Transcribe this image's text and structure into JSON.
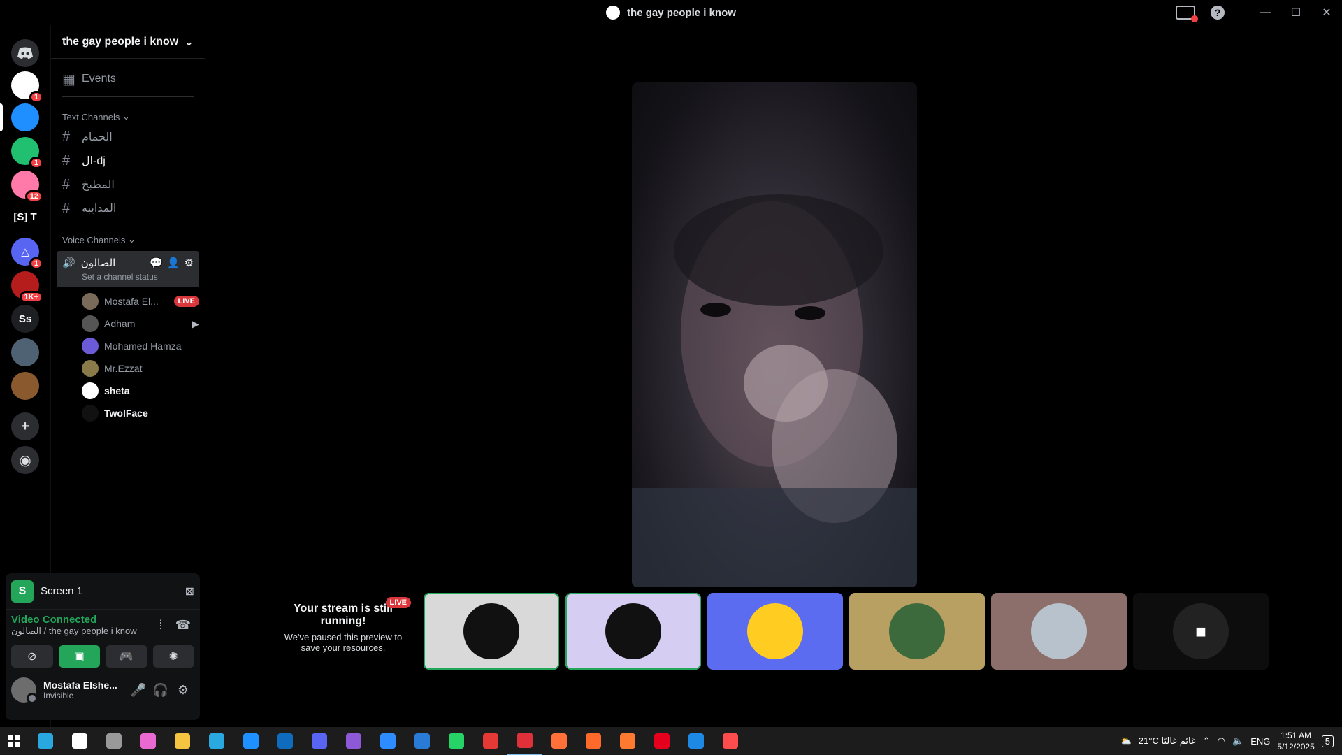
{
  "window": {
    "title": "the gay people i know"
  },
  "rail": {
    "servers": [
      {
        "name": "server-1",
        "badge": "1",
        "color": "#ffffff",
        "label": ""
      },
      {
        "name": "server-2",
        "badge": "",
        "color": "#1f8fff",
        "label": ""
      },
      {
        "name": "server-3",
        "badge": "1",
        "color": "#20c070",
        "label": ""
      },
      {
        "name": "server-4",
        "badge": "12",
        "color": "#ff7aa8",
        "label": ""
      },
      {
        "name": "server-5",
        "badge": "",
        "color": "#000000",
        "label": "[S] T"
      },
      {
        "name": "server-6",
        "badge": "1",
        "color": "#5865f2",
        "label": "△"
      },
      {
        "name": "server-7",
        "badge": "1K+",
        "color": "#b51d1d",
        "label": ""
      },
      {
        "name": "server-8",
        "badge": "",
        "color": "#1e1f22",
        "label": "Ss"
      },
      {
        "name": "server-9",
        "badge": "",
        "color": "#4f6273",
        "label": ""
      },
      {
        "name": "server-10",
        "badge": "",
        "color": "#8a5a2e",
        "label": ""
      }
    ]
  },
  "sidebar": {
    "guild_name": "the gay people i know",
    "events": "Events",
    "text_category": "Text Channels",
    "text_channels": [
      "الحمام",
      "ال-dj",
      "المطبخ",
      "المدايبه"
    ],
    "voice_category": "Voice Channels",
    "voice_channel": {
      "name": "الصالون",
      "status": "Set a channel status"
    },
    "members": [
      {
        "name": "Mostafa El...",
        "tag": "LIVE",
        "color": "#7a6a5a"
      },
      {
        "name": "Adham",
        "tag": "",
        "color": "#555555"
      },
      {
        "name": "Mohamed Hamza",
        "tag": "",
        "color": "#6b5bd6"
      },
      {
        "name": "Mr.Ezzat",
        "tag": "",
        "color": "#8a7a4a"
      },
      {
        "name": "sheta",
        "tag": "",
        "color": "#ffffff"
      },
      {
        "name": "TwolFace",
        "tag": "",
        "color": "#111111"
      }
    ]
  },
  "panel": {
    "screen_label": "Screen 1",
    "vc_title": "Video Connected",
    "vc_sub": "الصالون / the gay people i know",
    "user_name": "Mostafa Elshe...",
    "user_status": "Invisible"
  },
  "stage": {
    "paused_title": "Your stream is still running!",
    "paused_body": "We've paused this preview to save your resources.",
    "live_tag": "LIVE",
    "tiles": [
      {
        "bg": "#d9d9d9",
        "avatar": "#111111",
        "active": true
      },
      {
        "bg": "#d6cdf2",
        "avatar": "#111111",
        "active": true
      },
      {
        "bg": "#5c6cf0",
        "avatar": "#ffcc22",
        "active": false
      },
      {
        "bg": "#b8a062",
        "avatar": "#3c6a3c",
        "active": false
      },
      {
        "bg": "#8c6e6a",
        "avatar": "#b8c2cc",
        "active": false
      },
      {
        "bg": "#0d0d0d",
        "avatar": "#222222",
        "active": false
      }
    ]
  },
  "taskbar": {
    "weather": "21°C غائم غالبًا",
    "lang": "ENG",
    "time": "1:51 AM",
    "date": "5/12/2025",
    "notif": "5",
    "apps": [
      "#29a8e0",
      "#ffffff",
      "#999999",
      "#e86ad0",
      "#f5c542",
      "#2aa8e0",
      "#1e90ff",
      "#0f6cbd",
      "#5865f2",
      "#8e59d6",
      "#2d8cff",
      "#2a7bd6",
      "#25d366",
      "#e53935",
      "#e0303a",
      "#ff7139",
      "#ff6a2b",
      "#ff7a30",
      "#e5001e",
      "#1e88e5",
      "#ff4d4d"
    ]
  },
  "colors": {
    "accent_green": "#23a55a",
    "live_red": "#da373c",
    "blurple": "#5865f2"
  }
}
